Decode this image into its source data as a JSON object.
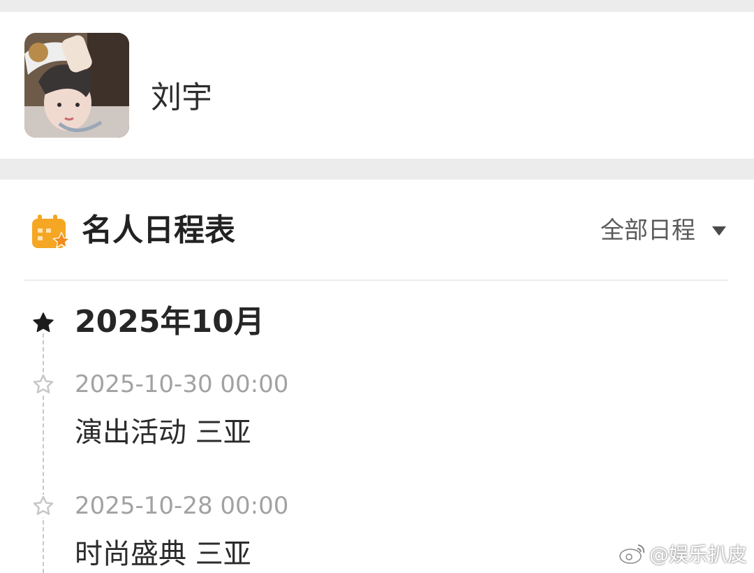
{
  "profile": {
    "name": "刘宇"
  },
  "schedule": {
    "title": "名人日程表",
    "filter_label": "全部日程",
    "month": "2025年10月",
    "events": [
      {
        "time": "2025-10-30 00:00",
        "title": "演出活动 三亚"
      },
      {
        "time": "2025-10-28 00:00",
        "title": "时尚盛典 三亚"
      }
    ]
  },
  "watermark": {
    "text": "@娱乐扒皮",
    "icon": "weibo-logo-icon"
  },
  "colors": {
    "calendar_icon": "#f5a623",
    "star_filled": "#1c1c1c",
    "star_outline": "#c8c8c8",
    "divider": "#ececec",
    "background_gap": "#ececec"
  }
}
